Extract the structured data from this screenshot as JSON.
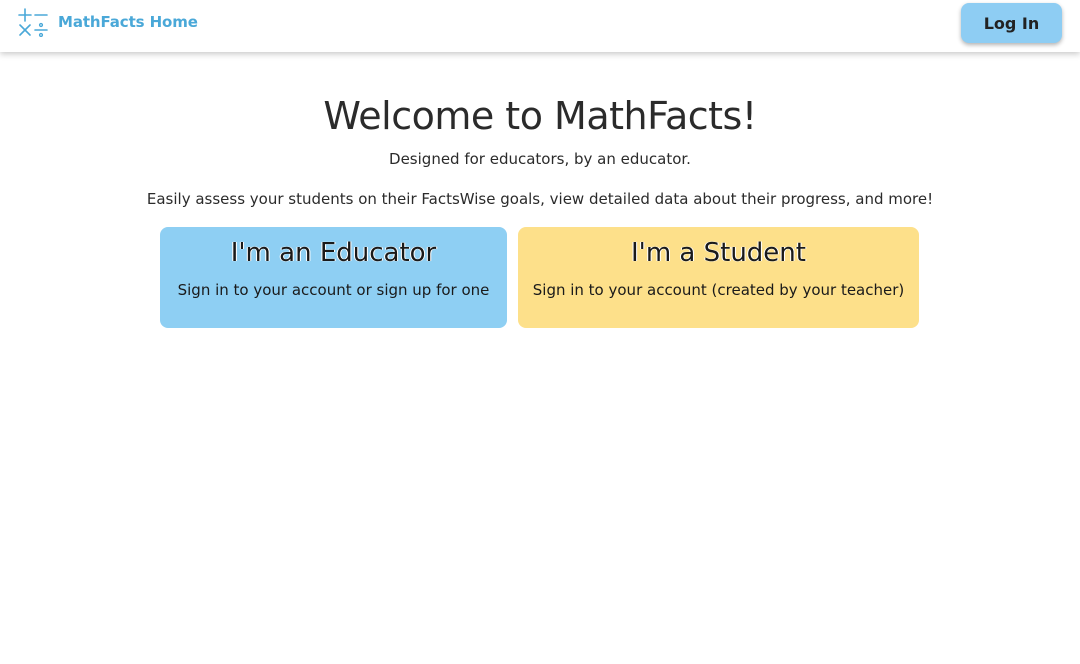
{
  "navbar": {
    "brand_text": "MathFacts Home",
    "brand_icon": "math-operators-icon",
    "login_label": "Log In"
  },
  "hero": {
    "title": "Welcome to MathFacts!",
    "subtitle": "Designed for educators, by an educator.",
    "description": "Easily assess your students on their FactsWise goals, view detailed data about their progress, and more!"
  },
  "cards": [
    {
      "title": "I'm an Educator",
      "description": "Sign in to your account or sign up for one",
      "color": "#8ecff3"
    },
    {
      "title": "I'm a Student",
      "description": "Sign in to your account (created by your teacher)",
      "color": "#fde08a"
    }
  ],
  "colors": {
    "brand": "#4aa8d8",
    "login_button": "#8ecdf3"
  }
}
